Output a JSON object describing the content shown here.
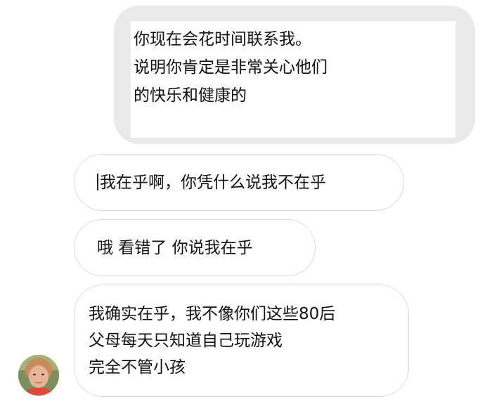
{
  "messages": {
    "sent": {
      "lines": [
        "你现在会花时间联系我。",
        "说明你肯定是非常关心他们",
        "的快乐和健康的"
      ]
    },
    "received": [
      {
        "text": "我在乎啊，你凭什么说我不在乎"
      },
      {
        "text": "哦 看错了 你说我在乎"
      },
      {
        "lines": [
          "我确实在乎，我不像你们这些80后",
          "父母每天只知道自己玩游戏",
          "完全不管小孩"
        ]
      }
    ]
  },
  "colors": {
    "sent_bubble": "#e9e9e9",
    "received_border": "#dcdcdc"
  },
  "icons": {
    "avatar": "contact-avatar-photo"
  }
}
